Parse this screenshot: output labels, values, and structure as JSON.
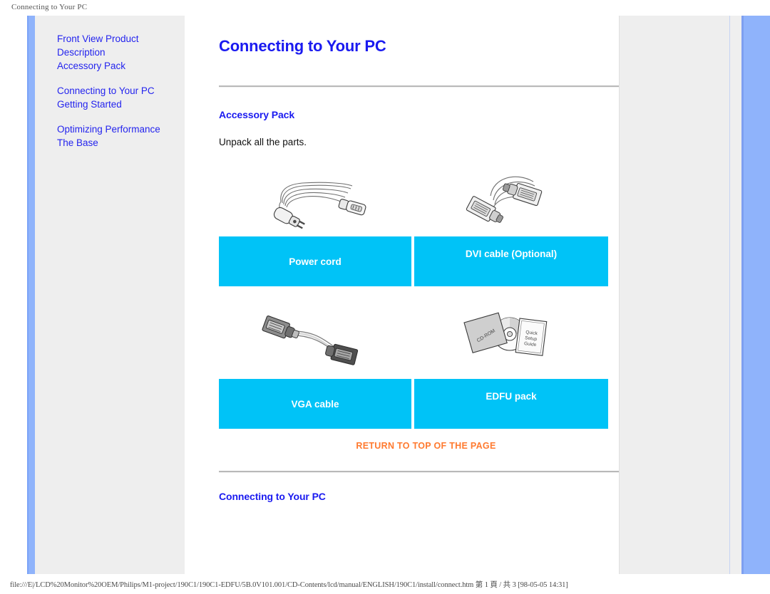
{
  "browser": {
    "print_header": "Connecting to Your PC",
    "print_footer": "file:///E|/LCD%20Monitor%20OEM/Philips/M1-project/190C1/190C1-EDFU/5B.0V101.001/CD-Contents/lcd/manual/ENGLISH/190C1/install/connect.htm 第 1 頁 / 共 3 [98-05-05 14:31]"
  },
  "sidebar": {
    "groups": [
      {
        "items": [
          {
            "label": "Front View Product Description",
            "name": "front-view-product-description"
          },
          {
            "label": "Accessory Pack",
            "name": "accessory-pack"
          }
        ]
      },
      {
        "items": [
          {
            "label": "Connecting to Your PC",
            "name": "connecting-to-your-pc"
          },
          {
            "label": "Getting Started",
            "name": "getting-started"
          }
        ]
      },
      {
        "items": [
          {
            "label": "Optimizing Performance",
            "name": "optimizing-performance"
          },
          {
            "label": "The Base",
            "name": "the-base"
          }
        ]
      }
    ]
  },
  "main": {
    "page_title": "Connecting to Your PC",
    "section_accessory": "Accessory Pack",
    "intro_text": "Unpack all the parts.",
    "section_connecting": "Connecting to Your PC",
    "return_to_top": "RETURN TO TOP OF THE PAGE",
    "accessories": [
      {
        "label": "Power cord",
        "icon": "power-cord-image"
      },
      {
        "label": "DVI cable (Optional)",
        "icon": "dvi-cable-image"
      },
      {
        "label": "VGA cable",
        "icon": "vga-cable-image"
      },
      {
        "label": "EDFU pack",
        "icon": "edfu-pack-image"
      }
    ],
    "edfu_labels": {
      "cd_sleeve": "CD-ROM",
      "booklet_line1": "Quick",
      "booklet_line2": "Setup",
      "booklet_line3": "Guide"
    }
  },
  "colors": {
    "link_blue": "#2424ee",
    "heading_blue": "#1a1af0",
    "label_cyan": "#00c3f7",
    "return_orange": "#ff7a2f",
    "panel_grey": "#eeeeee",
    "accent_blue": "#8fb3fb"
  }
}
